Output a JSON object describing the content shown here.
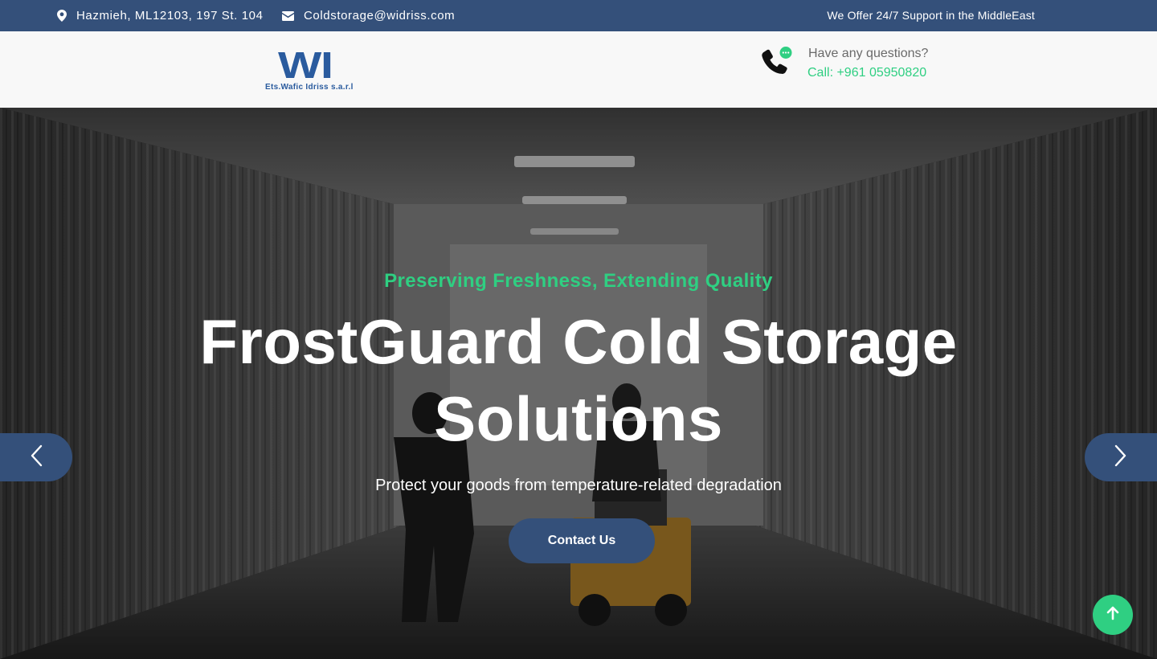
{
  "topbar": {
    "address": "Hazmieh, ML12103, 197 St. 104",
    "email": "Coldstorage@widriss.com",
    "support": "We Offer 24/7 Support in the MiddleEast",
    "address_icon": "map-marker-icon",
    "email_icon": "envelope-icon"
  },
  "header": {
    "logo": {
      "mark": "WI",
      "name": "Ets.Wafic Idriss s.a.r.l"
    },
    "contact": {
      "question": "Have any questions?",
      "call": "Call: +961 05950820",
      "icon": "phone-chat-icon"
    }
  },
  "hero": {
    "tagline": "Preserving Freshness, Extending Quality",
    "headline": "FrostGuard Cold Storage Solutions",
    "subline": "Protect your goods from temperature-related degradation",
    "cta_label": "Contact Us",
    "prev_icon": "chevron-left-icon",
    "next_icon": "chevron-right-icon"
  },
  "back_to_top_icon": "arrow-up-icon",
  "colors": {
    "brand_navy": "#34507a",
    "accent_green": "#2fcf82",
    "logo_blue": "#2a5b9e"
  }
}
